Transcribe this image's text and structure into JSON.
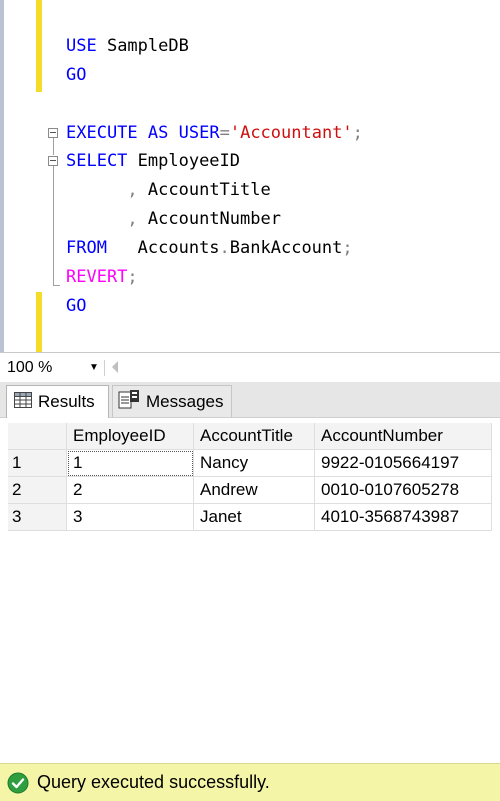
{
  "editor": {
    "lines": [
      {
        "tokens": [
          {
            "t": "USE",
            "c": "kw"
          },
          {
            "t": " SampleDB",
            "c": ""
          }
        ]
      },
      {
        "tokens": [
          {
            "t": "GO",
            "c": "kw"
          }
        ]
      },
      {
        "tokens": []
      },
      {
        "tokens": [
          {
            "t": "EXECUTE",
            "c": "kw"
          },
          {
            "t": " ",
            "c": ""
          },
          {
            "t": "AS",
            "c": "kw"
          },
          {
            "t": " ",
            "c": ""
          },
          {
            "t": "USER",
            "c": "kw"
          },
          {
            "t": "=",
            "c": "gray"
          },
          {
            "t": "'Accountant'",
            "c": "str"
          },
          {
            "t": ";",
            "c": "gray"
          }
        ]
      },
      {
        "tokens": [
          {
            "t": "SELECT",
            "c": "kw"
          },
          {
            "t": " EmployeeID",
            "c": ""
          }
        ]
      },
      {
        "tokens": [
          {
            "t": "      ",
            "c": ""
          },
          {
            "t": ",",
            "c": "gray"
          },
          {
            "t": " AccountTitle",
            "c": ""
          }
        ]
      },
      {
        "tokens": [
          {
            "t": "      ",
            "c": ""
          },
          {
            "t": ",",
            "c": "gray"
          },
          {
            "t": " AccountNumber",
            "c": ""
          }
        ]
      },
      {
        "tokens": [
          {
            "t": "FROM",
            "c": "kw"
          },
          {
            "t": "   Accounts",
            "c": ""
          },
          {
            "t": ".",
            "c": "gray"
          },
          {
            "t": "BankAccount",
            "c": ""
          },
          {
            "t": ";",
            "c": "gray"
          }
        ]
      },
      {
        "tokens": [
          {
            "t": "REVERT",
            "c": "mg"
          },
          {
            "t": ";",
            "c": "gray"
          }
        ]
      },
      {
        "tokens": [
          {
            "t": "GO",
            "c": "kw"
          }
        ]
      }
    ]
  },
  "zoom": {
    "value": "100 %",
    "arrow": "▼"
  },
  "tabs": {
    "results_label": "Results",
    "messages_label": "Messages"
  },
  "grid": {
    "columns": [
      "",
      "EmployeeID",
      "AccountTitle",
      "AccountNumber"
    ],
    "rows": [
      [
        "1",
        "1",
        "Nancy",
        "9922-0105664197"
      ],
      [
        "2",
        "2",
        "Andrew",
        "0010-0107605278"
      ],
      [
        "3",
        "3",
        "Janet",
        "4010-3568743987"
      ]
    ]
  },
  "status": {
    "text": "Query executed successfully.",
    "color": "#f5f5a8",
    "icon": "check-circle-icon"
  },
  "colors": {
    "keyword": "#0000ff",
    "string": "#cc1010",
    "operator": "#808080",
    "function": "#ff00ff",
    "change_marker": "#f5dc28"
  }
}
